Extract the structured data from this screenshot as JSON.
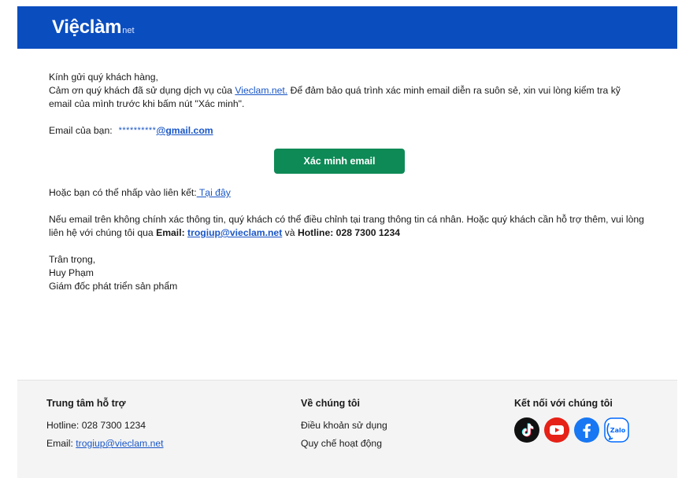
{
  "header": {
    "logo_main": "Việclàm",
    "logo_sub": "net",
    "brand_color": "#0a4dbf"
  },
  "body": {
    "greeting": "Kính gửi quý khách hàng,",
    "intro_before": "Cảm ơn quý khách đã sử dụng dịch vụ của ",
    "intro_link": "Vieclam.net.",
    "intro_after": " Để đảm bảo quá trình xác minh email diễn ra suôn sẻ, xin vui lòng kiểm tra kỹ email của mình trước khi bấm nút \"Xác minh\".",
    "email_label": "Email của bạn:",
    "email_mask": "**********",
    "email_domain": "@gmail.com",
    "verify_button": "Xác minh email",
    "alt_text": "Hoặc bạn có thể nhấp vào liên kết:",
    "alt_link": " Tại đây",
    "support_text": "Nếu email trên không chính xác thông tin, quý khách có thể điều chỉnh tại trang thông tin cá nhân. Hoặc quý khách cần hỗ trợ thêm, vui lòng liên hệ với chúng tôi qua ",
    "support_email_label": "Email:",
    "support_email": "trogiup@vieclam.net",
    "support_and": " và ",
    "support_hotline": "Hotline: 028 7300 1234",
    "signoff": "Trân trọng,",
    "signer_name": "Huy Phạm",
    "signer_title": "Giám đốc phát triển sản phẩm",
    "button_color": "#0e8a56"
  },
  "footer": {
    "support_title": "Trung tâm hỗ trợ",
    "hotline": "Hotline: 028 7300 1234",
    "email_label": "Email: ",
    "email": "trogiup@vieclam.net",
    "about_title": "Về chúng tôi",
    "terms": "Điều khoản sử dụng",
    "regulations": "Quy chế hoạt động",
    "connect_title": "Kết nối với chúng tôi",
    "social": [
      "tiktok-icon",
      "youtube-icon",
      "facebook-icon",
      "zalo-icon"
    ],
    "zalo_text": "Zalo"
  }
}
